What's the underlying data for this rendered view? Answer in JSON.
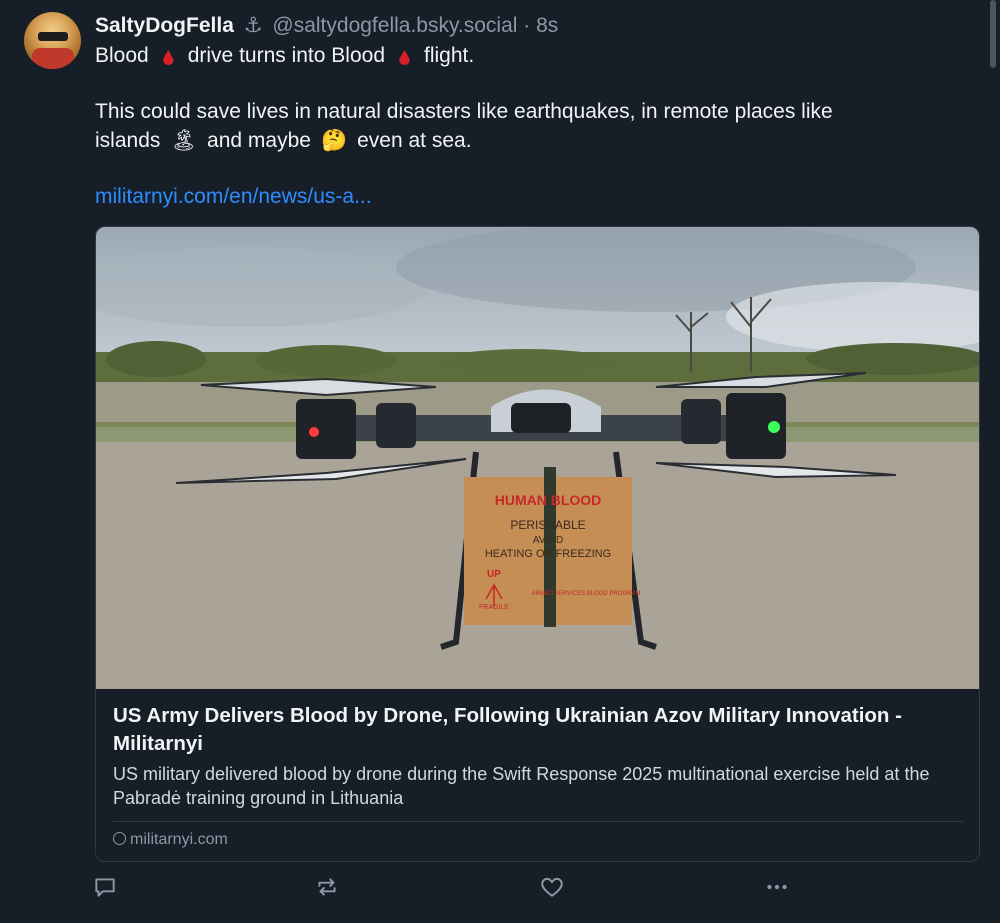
{
  "post": {
    "display_name": "SaltyDogFella",
    "anchor_emoji": "⚓",
    "handle": "@saltydogfella.bsky.social",
    "separator": "·",
    "time": "8s",
    "line1": {
      "part1": "Blood",
      "part2": "drive turns into Blood",
      "part3": "flight."
    },
    "line2": {
      "part1": "This could save lives in natural  disasters  like earthquakes, in remote places like",
      "part2": "islands",
      "island_emoji": "🏝",
      "part3": "and maybe",
      "thinking_emoji": "🤔",
      "part4": "even at sea."
    },
    "link_text": "militarnyi.com/en/news/us-a..."
  },
  "card": {
    "title": "US Army Delivers Blood by Drone, Following Ukrainian Azov Military Innovation - Militarnyi",
    "description": "US military delivered blood by drone during the Swift Response 2025 multinational exercise held at the Pabradė training ground in Lithuania",
    "domain": "militarnyi.com",
    "image": {
      "box_label_1": "HUMAN BLOOD",
      "box_label_2": "PERISHABLE",
      "box_label_3": "AVOID",
      "box_label_4": "HEATING OR FREEZING",
      "box_label_5": "UP",
      "box_label_6": "FRAGILE",
      "box_label_7": "ARMED SERVICES BLOOD PROGRAM"
    }
  },
  "actions": {
    "reply_icon": "reply-icon",
    "repost_icon": "repost-icon",
    "like_icon": "heart-icon",
    "more_icon": "more-icon"
  },
  "colors": {
    "background": "#161e27",
    "link": "#2f8cff",
    "muted": "#8b98a5",
    "blood_drop": "#d8202b"
  }
}
